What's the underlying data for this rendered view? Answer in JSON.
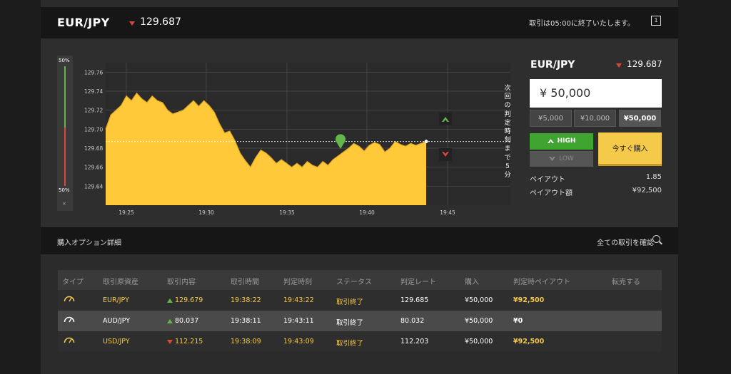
{
  "header": {
    "pair": "EUR/JPY",
    "rate": "129.687",
    "close_message": "取引は05:00に終了いたします。",
    "icon": "window-icon"
  },
  "sentiment": {
    "top_pct": "50%",
    "bottom_pct": "50%",
    "close": "×",
    "high_fraction": 0.5
  },
  "chart_data": {
    "type": "area",
    "x_ticks": [
      "19:25",
      "19:30",
      "19:35",
      "19:40",
      "19:45"
    ],
    "y_ticks": [
      "129.76",
      "129.74",
      "129.72",
      "129.70",
      "129.68",
      "129.66",
      "129.64"
    ],
    "ylim": [
      129.62,
      129.77
    ],
    "current_rate": 129.687,
    "fill_color": "#ffc93a",
    "series": [
      {
        "values": [
          129.7,
          129.715,
          129.72,
          129.725,
          129.735,
          129.73,
          129.738,
          129.732,
          129.728,
          129.735,
          129.73,
          129.728,
          129.72,
          129.716,
          129.718,
          129.72,
          129.725,
          129.73,
          129.724,
          129.73,
          129.725,
          129.718,
          129.706,
          129.696,
          129.698,
          129.688,
          129.675,
          129.667,
          129.66,
          129.67,
          129.678,
          129.675,
          129.67,
          129.664,
          129.668,
          129.664,
          129.66,
          129.664,
          129.66,
          129.666,
          129.662,
          129.66,
          129.666,
          129.662,
          129.668,
          129.672,
          129.676,
          129.68,
          129.685,
          129.682,
          129.677,
          129.683,
          129.686,
          129.684,
          129.676,
          129.68,
          129.687,
          129.684,
          129.682,
          129.685,
          129.683,
          129.685,
          129.687
        ]
      }
    ]
  },
  "countdown": [
    "次",
    "回",
    "の",
    "判",
    "定",
    "時",
    "刻",
    "ま",
    "で",
    "5",
    "分"
  ],
  "trade": {
    "pair": "EUR/JPY",
    "rate": "129.687",
    "amount": "¥ 50,000",
    "presets": [
      "¥5,000",
      "¥10,000",
      "¥50,000"
    ],
    "high": "HIGH",
    "low": "LOW",
    "buy": "今すぐ購入",
    "payout_label": "ペイアウト",
    "payout_value": "1.85",
    "payout_amount_label": "ペイアウト額",
    "payout_amount_value": "¥92,500"
  },
  "details": {
    "title": "購入オプション詳細",
    "view_all": "全ての取引を確認"
  },
  "table": {
    "headers": [
      "タイプ",
      "取引原資産",
      "取引内容",
      "取引時間",
      "判定時刻",
      "ステータス",
      "判定レート",
      "購入",
      "判定時ペイアウト",
      "転売する"
    ],
    "rows": [
      {
        "asset": "EUR/JPY",
        "dir": "up",
        "entry": "129.679",
        "time": "19:38:22",
        "expiry": "19:43:22",
        "status": "取引終了",
        "close_rate": "129.685",
        "amount": "¥50,000",
        "payout": "¥92,500",
        "win": true
      },
      {
        "asset": "AUD/JPY",
        "dir": "up",
        "entry": "80.037",
        "time": "19:38:11",
        "expiry": "19:43:11",
        "status": "取引終了",
        "close_rate": "80.032",
        "amount": "¥50,000",
        "payout": "¥0",
        "win": false
      },
      {
        "asset": "USD/JPY",
        "dir": "down",
        "entry": "112.215",
        "time": "19:38:09",
        "expiry": "19:43:09",
        "status": "取引終了",
        "close_rate": "112.203",
        "amount": "¥50,000",
        "payout": "¥92,500",
        "win": true
      }
    ]
  },
  "colors": {
    "win_row_text": "#f5c94a",
    "loss_row_text": "#ffffff",
    "row_bg_alt": "#4a4a4a",
    "row_bg": "#2e2e2e"
  }
}
